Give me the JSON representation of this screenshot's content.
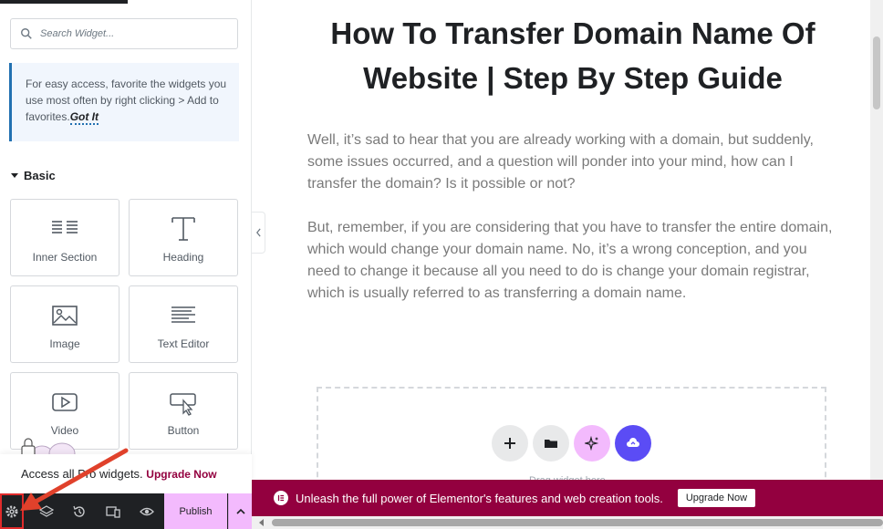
{
  "panel": {
    "search_placeholder": "Search Widget...",
    "tip_text": "For easy access, favorite the widgets you use most often by right clicking > Add to favorites.",
    "tip_link": "Got It",
    "category": "Basic",
    "widgets": [
      {
        "label": "Inner Section",
        "icon": "inner-section-icon"
      },
      {
        "label": "Heading",
        "icon": "heading-icon"
      },
      {
        "label": "Image",
        "icon": "image-icon"
      },
      {
        "label": "Text Editor",
        "icon": "text-editor-icon"
      },
      {
        "label": "Video",
        "icon": "video-icon"
      },
      {
        "label": "Button",
        "icon": "button-icon"
      }
    ],
    "promo_text": "Access all Pro widgets.",
    "promo_link": "Upgrade Now"
  },
  "bottombar": {
    "publish_label": "Publish",
    "buttons": [
      "settings-icon",
      "layers-icon",
      "history-icon",
      "responsive-icon",
      "preview-icon"
    ]
  },
  "preview": {
    "title": "How To Transfer Domain Name Of Website | Step By Step Guide",
    "paragraph1": "Well, it’s sad to hear that you are already working with a domain, but suddenly, some issues occurred, and a question will ponder into your mind, how can I transfer the domain? Is it possible or not?",
    "paragraph2": "But, remember, if you are considering that you have to transfer the entire domain, which would change your domain name. No, it’s a wrong conception, and you need to change it because all you need to do is change your domain registrar, which is usually referred to as transferring a domain name.",
    "dropzone_text": "Drag widget here"
  },
  "banner": {
    "text": "Unleash the full power of Elementor's features and web creation tools.",
    "button": "Upgrade Now"
  },
  "colors": {
    "accent": "#93003f",
    "publish_bg": "#f3bafd",
    "dark": "#1f2124",
    "ai_button": "#f3bafd",
    "kit_button": "#5b4cf5"
  }
}
